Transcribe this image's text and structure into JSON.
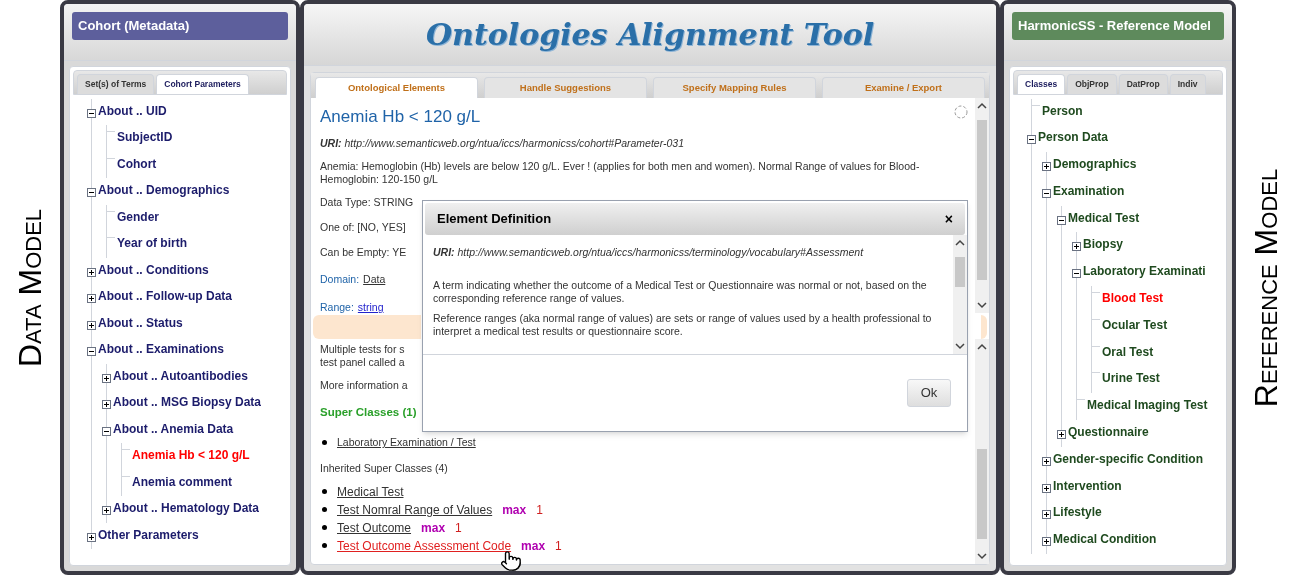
{
  "side_labels": {
    "left": "Data Model",
    "right": "Reference Model"
  },
  "left_panel": {
    "title": "Cohort (Metadata)",
    "tabs": [
      {
        "label": "Set(s) of Terms",
        "selected": false
      },
      {
        "label": "Cohort Parameters",
        "selected": true
      }
    ],
    "tree": [
      {
        "label": "About .. UID",
        "expanded": true,
        "selected": false,
        "children": [
          {
            "label": "SubjectID",
            "selected": false
          },
          {
            "label": "Cohort",
            "selected": false
          }
        ]
      },
      {
        "label": "About .. Demographics",
        "expanded": true,
        "selected": false,
        "children": [
          {
            "label": "Gender",
            "selected": false
          },
          {
            "label": "Year of birth",
            "selected": false
          }
        ]
      },
      {
        "label": "About .. Conditions",
        "expanded": false,
        "selected": false
      },
      {
        "label": "About .. Follow-up Data",
        "expanded": false,
        "selected": false
      },
      {
        "label": "About .. Status",
        "expanded": false,
        "selected": false
      },
      {
        "label": "About .. Examinations",
        "expanded": true,
        "selected": false,
        "children": [
          {
            "label": "About .. Autoantibodies",
            "expanded": false,
            "selected": false
          },
          {
            "label": "About .. MSG Biopsy Data",
            "expanded": false,
            "selected": false
          },
          {
            "label": "About .. Anemia Data",
            "expanded": true,
            "selected": false,
            "children": [
              {
                "label": "Anemia Hb < 120 g/L",
                "selected": true
              },
              {
                "label": "Anemia comment",
                "selected": false
              }
            ]
          },
          {
            "label": "About .. Hematology Data",
            "expanded": false,
            "selected": false
          }
        ]
      },
      {
        "label": "Other Parameters",
        "expanded": false,
        "selected": false
      }
    ]
  },
  "center_panel": {
    "title": "Ontologies Alignment Tool",
    "tabs": [
      {
        "label": "Ontological Elements",
        "selected": true
      },
      {
        "label": "Handle Suggestions",
        "selected": false
      },
      {
        "label": "Specify Mapping Rules",
        "selected": false
      },
      {
        "label": "Examine / Export",
        "selected": false
      }
    ],
    "element": {
      "heading": "Anemia Hb < 120 g/L",
      "uri": "**URI:** http://www.semanticweb.org/ntua/iccs/harmonicss/cohort#Parameter-031",
      "description": "Anemia: Hemoglobin (Hb) levels are below 120 g/L. Ever ! (applies for both men and women). Normal Range of values for Blood-Hemoglobin: 120-150 g/L",
      "facts": [
        "Data Type: STRING",
        "One of: [NO, YES]",
        "Can be Empty: YE"
      ],
      "domain": {
        "label": "Domain:",
        "value": "Data"
      },
      "range": {
        "label": "Range:",
        "value": "string"
      },
      "note_lines": [
        "Multiple tests for s",
        "test panel called a"
      ],
      "more_info": "More information a",
      "super_classes": {
        "heading": "Super Classes (1)",
        "items": [
          "Laboratory Examination / Test"
        ]
      },
      "inherited": {
        "heading": "Inherited Super Classes (4)",
        "items": [
          {
            "label": "Medical Test",
            "highlighted": false
          },
          {
            "label": "Test Nomral Range of Values",
            "restriction": "max",
            "count": "1",
            "highlighted": false
          },
          {
            "label": "Test Outcome",
            "restriction": "max",
            "count": "1",
            "highlighted": false
          },
          {
            "label": "Test Outcome Assessment Code",
            "restriction": "max",
            "count": "1",
            "highlighted": true
          }
        ]
      }
    },
    "dialog": {
      "title": "Element Definition",
      "close": "×",
      "uri": "**URI:** http://www.semanticweb.org/ntua/iccs/harmonicss/terminology/vocabulary#Assessment",
      "paragraphs": [
        "A term indicating whether the outcome of a Medical Test or Questionnaire was normal or not, based on the corresponding reference range of values.",
        "Reference ranges (aka normal range of values) are sets or range of values used by a health professional to interpret a medical test results or questionnaire score."
      ],
      "button": "Ok"
    }
  },
  "right_panel": {
    "title": "HarmonicSS - Reference Model",
    "tabs": [
      {
        "label": "Classes",
        "selected": true
      },
      {
        "label": "ObjProp",
        "selected": false
      },
      {
        "label": "DatProp",
        "selected": false
      },
      {
        "label": "Indiv",
        "selected": false
      }
    ],
    "tree": [
      {
        "label": "Person",
        "selected": false
      },
      {
        "label": "Person Data",
        "expanded": true,
        "selected": false,
        "children": [
          {
            "label": "Demographics",
            "expanded": false,
            "selected": false
          },
          {
            "label": "Examination",
            "expanded": true,
            "selected": false,
            "children": [
              {
                "label": "Medical Test",
                "expanded": true,
                "selected": false,
                "children": [
                  {
                    "label": "Biopsy",
                    "expanded": false,
                    "selected": false
                  },
                  {
                    "label": "Laboratory Examinati",
                    "expanded": true,
                    "selected": false,
                    "children": [
                      {
                        "label": "Blood Test",
                        "selected": true
                      },
                      {
                        "label": "Ocular Test",
                        "selected": false
                      },
                      {
                        "label": "Oral Test",
                        "selected": false
                      },
                      {
                        "label": "Urine Test",
                        "selected": false
                      }
                    ]
                  },
                  {
                    "label": "Medical Imaging Test",
                    "selected": false
                  }
                ]
              },
              {
                "label": "Questionnaire",
                "expanded": false,
                "selected": false
              }
            ]
          },
          {
            "label": "Gender-specific Condition",
            "expanded": false,
            "selected": false
          },
          {
            "label": "Intervention",
            "expanded": false,
            "selected": false
          },
          {
            "label": "Lifestyle",
            "expanded": false,
            "selected": false
          },
          {
            "label": "Medical Condition",
            "expanded": false,
            "selected": false
          }
        ]
      }
    ]
  }
}
